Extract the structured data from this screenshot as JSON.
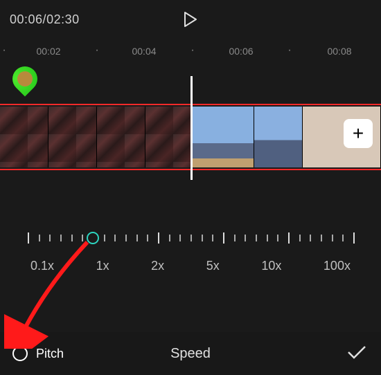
{
  "playback": {
    "current": "00:06",
    "total": "02:30",
    "separator": "/"
  },
  "ruler": {
    "marks": [
      "00:02",
      "00:04",
      "00:06",
      "00:08"
    ]
  },
  "add_clip_glyph": "+",
  "speed": {
    "labels": [
      "0.1x",
      "1x",
      "2x",
      "5x",
      "10x",
      "100x"
    ],
    "handle_index": 1
  },
  "bottom": {
    "pitch_label": "Pitch",
    "panel_title": "Speed"
  }
}
